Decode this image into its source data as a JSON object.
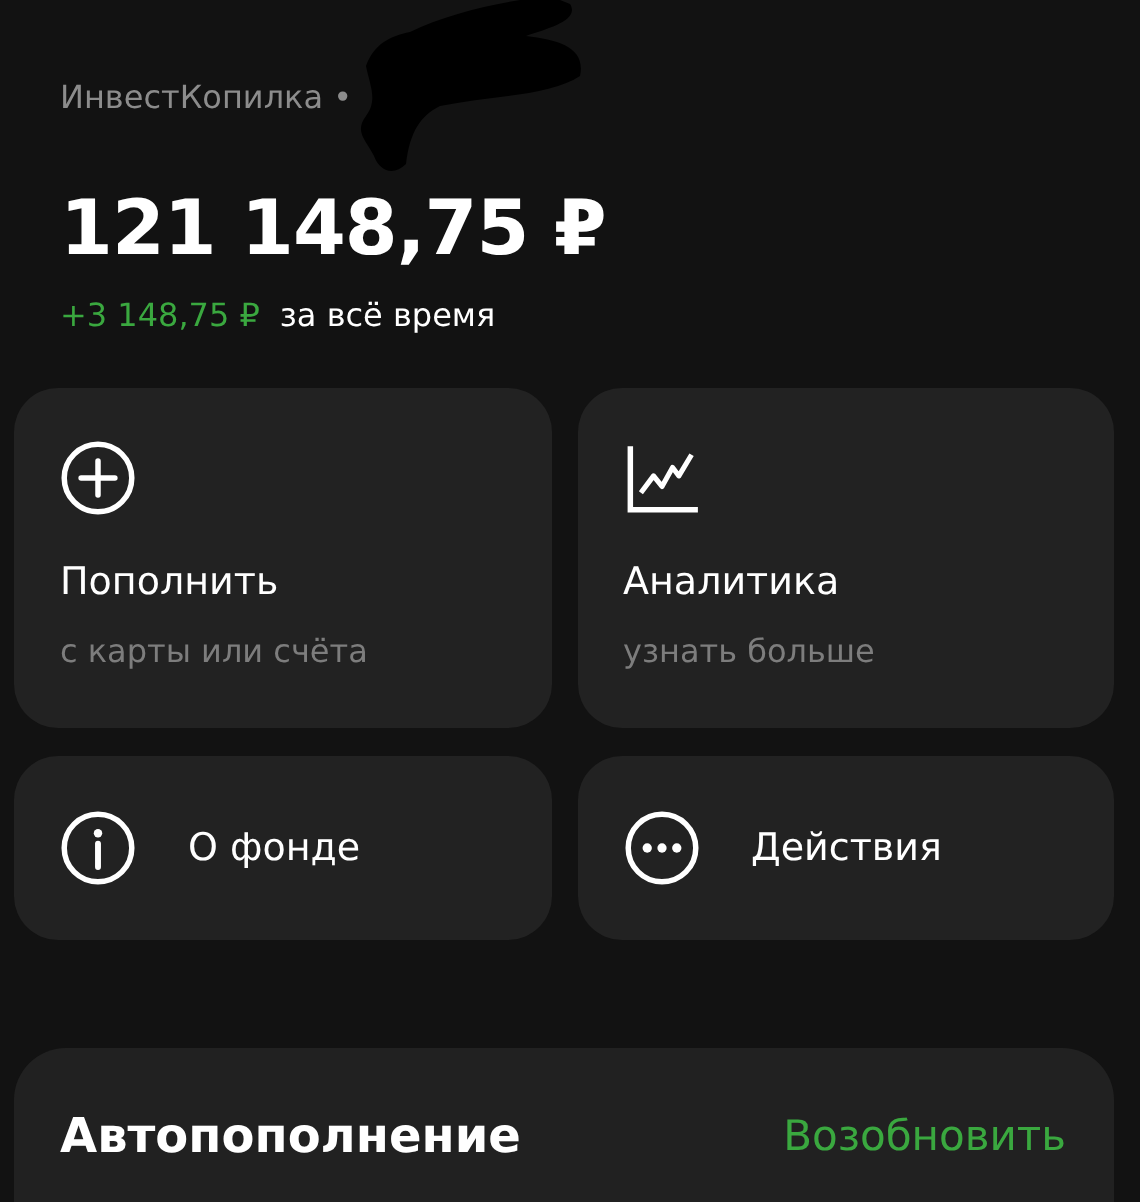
{
  "header": {
    "product": "ИнвестКопилка •"
  },
  "balance": "121 148,75 ₽",
  "gain": {
    "amount": "+3 148,75 ₽",
    "caption": "за всё время"
  },
  "actions": [
    {
      "kind": "tall",
      "title": "Пополнить",
      "subtitle": "с карты или счёта"
    },
    {
      "kind": "tall",
      "title": "Аналитика",
      "subtitle": "узнать больше"
    },
    {
      "kind": "short",
      "title": "О фонде"
    },
    {
      "kind": "short",
      "title": "Действия"
    }
  ],
  "autopay": {
    "title": "Автопополнение",
    "action": "Возобновить"
  }
}
